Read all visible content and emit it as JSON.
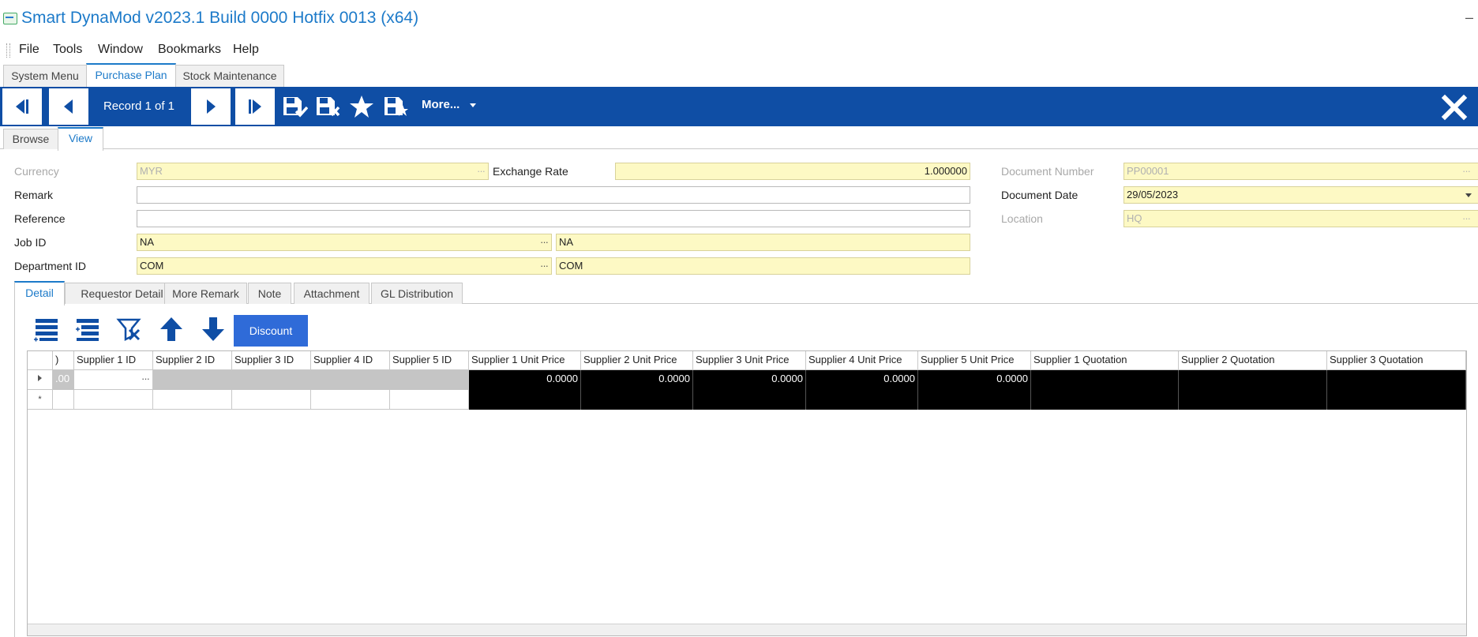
{
  "window": {
    "title": "Smart DynaMod v2023.1 Build 0000 Hotfix 0013 (x64)",
    "minimize_glyph": "–"
  },
  "menu": [
    "File",
    "Tools",
    "Window",
    "Bookmarks",
    "Help"
  ],
  "module_tabs": [
    {
      "label": "System Menu",
      "active": false
    },
    {
      "label": "Purchase Plan",
      "active": true
    },
    {
      "label": "Stock Maintenance",
      "active": false
    }
  ],
  "toolbar": {
    "record_label": "Record 1 of 1",
    "more_label": "More...",
    "icons": [
      "first-record-icon",
      "previous-record-icon",
      "next-record-icon",
      "last-record-icon",
      "save-icon",
      "cancel-save-icon",
      "bookmark-star-icon",
      "save-as-template-icon",
      "close-icon"
    ],
    "bg_color": "#0f4ea5"
  },
  "view_tabs": [
    {
      "label": "Browse",
      "active": false
    },
    {
      "label": "View",
      "active": true
    }
  ],
  "form": {
    "currency": {
      "label": "Currency",
      "value": "MYR"
    },
    "exchange_rate": {
      "label": "Exchange Rate",
      "value": "1.000000"
    },
    "document_number": {
      "label": "Document Number",
      "value": "PP00001"
    },
    "remark": {
      "label": "Remark",
      "value": ""
    },
    "document_date": {
      "label": "Document Date",
      "value": "29/05/2023"
    },
    "reference": {
      "label": "Reference",
      "value": ""
    },
    "location": {
      "label": "Location",
      "value": "HQ"
    },
    "job_id": {
      "label": "Job ID",
      "value": "NA",
      "description": "NA"
    },
    "department_id": {
      "label": "Department ID",
      "value": "COM",
      "description": "COM"
    }
  },
  "detail_tabs": [
    {
      "label": "Detail",
      "active": true
    },
    {
      "label": "Requestor Detail",
      "active": false
    },
    {
      "label": "More Remark",
      "active": false
    },
    {
      "label": "Note",
      "active": false
    },
    {
      "label": "Attachment",
      "active": false
    },
    {
      "label": "GL Distribution",
      "active": false
    }
  ],
  "grid_toolbar": {
    "icons": [
      "add-row-icon",
      "insert-row-icon",
      "delete-row-icon",
      "move-up-icon",
      "move-down-icon"
    ],
    "discount_label": "Discount"
  },
  "grid": {
    "columns": [
      ")",
      "Supplier 1 ID",
      "Supplier 2 ID",
      "Supplier 3 ID",
      "Supplier 4 ID",
      "Supplier 5 ID",
      "Supplier 1 Unit Price",
      "Supplier 2 Unit Price",
      "Supplier 3 Unit Price",
      "Supplier 4 Unit Price",
      "Supplier 5 Unit Price",
      "Supplier 1 Quotation",
      "Supplier 2 Quotation",
      "Supplier 3 Quotation"
    ],
    "rows": [
      {
        "indicator": "current",
        "cells": [
          ".00",
          "",
          "",
          "",
          "",
          "",
          "0.0000",
          "0.0000",
          "0.0000",
          "0.0000",
          "0.0000",
          "",
          "",
          ""
        ]
      }
    ],
    "new_row_indicator": "*"
  },
  "colors": {
    "accent": "#1c7ac9",
    "required_field": "#fdf9c4",
    "discount_button": "#2f6bd8"
  }
}
